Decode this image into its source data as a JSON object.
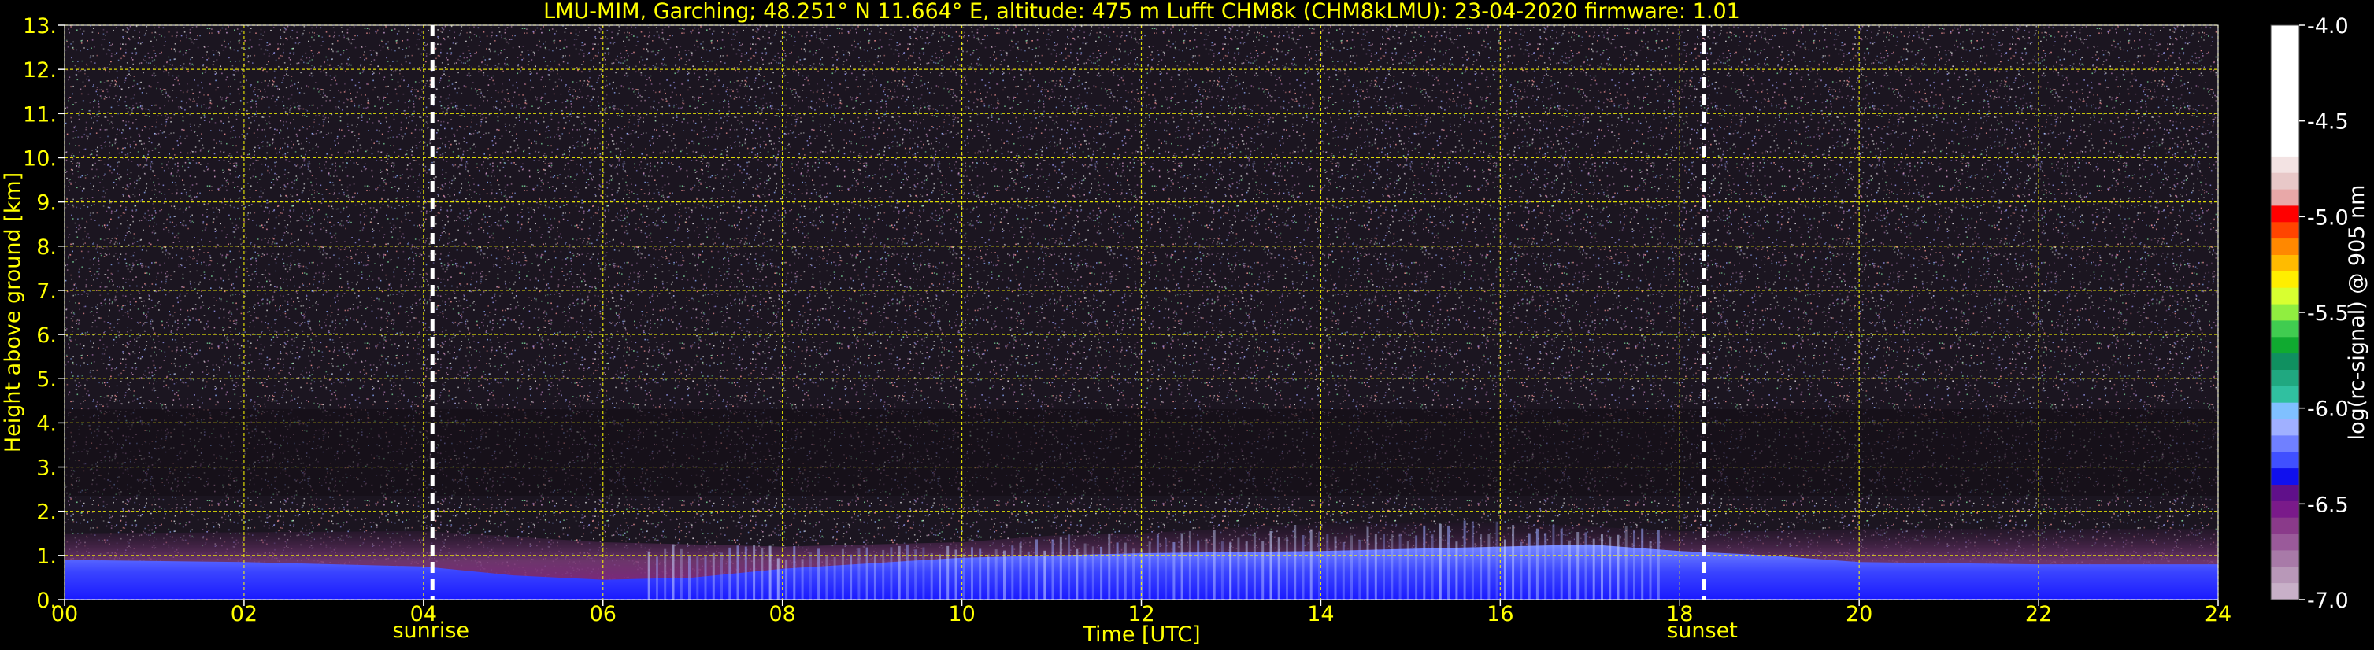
{
  "chart_data": {
    "type": "heatmap",
    "title": "LMU-MIM, Garching; 48.251° N 11.664° E, altitude: 475 m    Lufft CHM8k (CHM8kLMU): 23-04-2020    firmware: 1.01",
    "xlabel": "Time [UTC]",
    "ylabel": "Height above ground [km]",
    "xlim": [
      0,
      24
    ],
    "ylim": [
      0,
      13
    ],
    "x_ticks": [
      0,
      2,
      4,
      6,
      8,
      10,
      12,
      14,
      16,
      18,
      20,
      22,
      24
    ],
    "x_tick_labels": [
      "00",
      "02",
      "04",
      "06",
      "08",
      "10",
      "12",
      "14",
      "16",
      "18",
      "20",
      "22",
      "24"
    ],
    "y_ticks": [
      0,
      1,
      2,
      3,
      4,
      5,
      6,
      7,
      8,
      9,
      10,
      11,
      12,
      13
    ],
    "y_tick_labels": [
      "0.",
      "1.",
      "2.",
      "3.",
      "4.",
      "5.",
      "6.",
      "7.",
      "8.",
      "9.",
      "10.",
      "11.",
      "12.",
      "13."
    ],
    "grid": true,
    "events": [
      {
        "label": "sunrise",
        "time": 4.1
      },
      {
        "label": "sunset",
        "time": 18.27
      }
    ],
    "colorbar": {
      "label": "log(rc-signal) @ 905 nm",
      "range": [
        -7.0,
        -4.0
      ],
      "ticks": [
        -7.0,
        -6.5,
        -6.0,
        -5.5,
        -5.0,
        -4.5,
        -4.0
      ],
      "tick_labels": [
        "-7.0",
        "-6.5",
        "-6.0",
        "-5.5",
        "-5.0",
        "-4.5",
        "-4.0"
      ]
    },
    "layers": {
      "boundary_layer_top_km": [
        [
          0,
          1.5
        ],
        [
          4,
          1.55
        ],
        [
          6,
          1.3
        ],
        [
          8,
          1.2
        ],
        [
          10,
          1.3
        ],
        [
          11,
          1.45
        ],
        [
          12,
          1.5
        ],
        [
          13,
          1.62
        ],
        [
          14,
          1.72
        ],
        [
          15,
          1.75
        ],
        [
          16,
          1.75
        ],
        [
          17,
          1.65
        ],
        [
          18,
          1.55
        ],
        [
          19,
          1.55
        ],
        [
          20,
          1.6
        ],
        [
          22,
          1.6
        ],
        [
          24,
          1.6
        ]
      ],
      "strong_signal_top_km": [
        [
          0,
          0.9
        ],
        [
          2,
          0.85
        ],
        [
          4,
          0.75
        ],
        [
          5,
          0.55
        ],
        [
          6,
          0.45
        ],
        [
          7,
          0.5
        ],
        [
          8,
          0.7
        ],
        [
          10,
          0.95
        ],
        [
          12,
          1.05
        ],
        [
          14,
          1.1
        ],
        [
          16,
          1.2
        ],
        [
          17,
          1.25
        ],
        [
          18,
          1.1
        ],
        [
          19,
          1.0
        ],
        [
          20,
          0.85
        ],
        [
          22,
          0.8
        ],
        [
          24,
          0.8
        ]
      ]
    }
  },
  "colors": {
    "annotation_text": "#ffff00",
    "grid": "#ffff00",
    "event_line": "#ffffff",
    "background": "#000000"
  }
}
